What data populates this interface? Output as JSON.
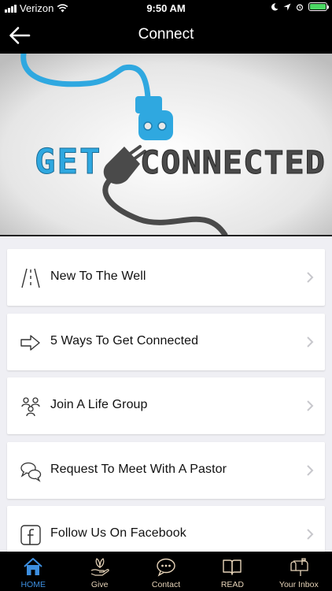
{
  "status_bar": {
    "carrier": "Verizon",
    "time": "9:50 AM"
  },
  "nav": {
    "title": "Connect"
  },
  "hero": {
    "text_left": "GET",
    "text_right": "CONNECTED",
    "colors": {
      "blue": "#2fa8e0",
      "gray": "#4a4a4a"
    }
  },
  "menu": {
    "items": [
      {
        "label": "New To The Well",
        "icon": "road-icon"
      },
      {
        "label": "5 Ways To Get Connected",
        "icon": "arrow-right-icon"
      },
      {
        "label": "Join A Life Group",
        "icon": "people-group-icon"
      },
      {
        "label": "Request To Meet With A Pastor",
        "icon": "chat-bubbles-icon"
      },
      {
        "label": "Follow Us On Facebook",
        "icon": "facebook-icon"
      }
    ]
  },
  "tab_bar": {
    "tabs": [
      {
        "label": "HOME",
        "icon": "home-icon",
        "active": true
      },
      {
        "label": "Give",
        "icon": "give-icon",
        "active": false
      },
      {
        "label": "Contact",
        "icon": "contact-icon",
        "active": false
      },
      {
        "label": "READ",
        "icon": "book-icon",
        "active": false
      },
      {
        "label": "Your Inbox",
        "icon": "mailbox-icon",
        "active": false
      }
    ],
    "active_color": "#3d8fe0",
    "inactive_color": "#e6d3b8"
  }
}
